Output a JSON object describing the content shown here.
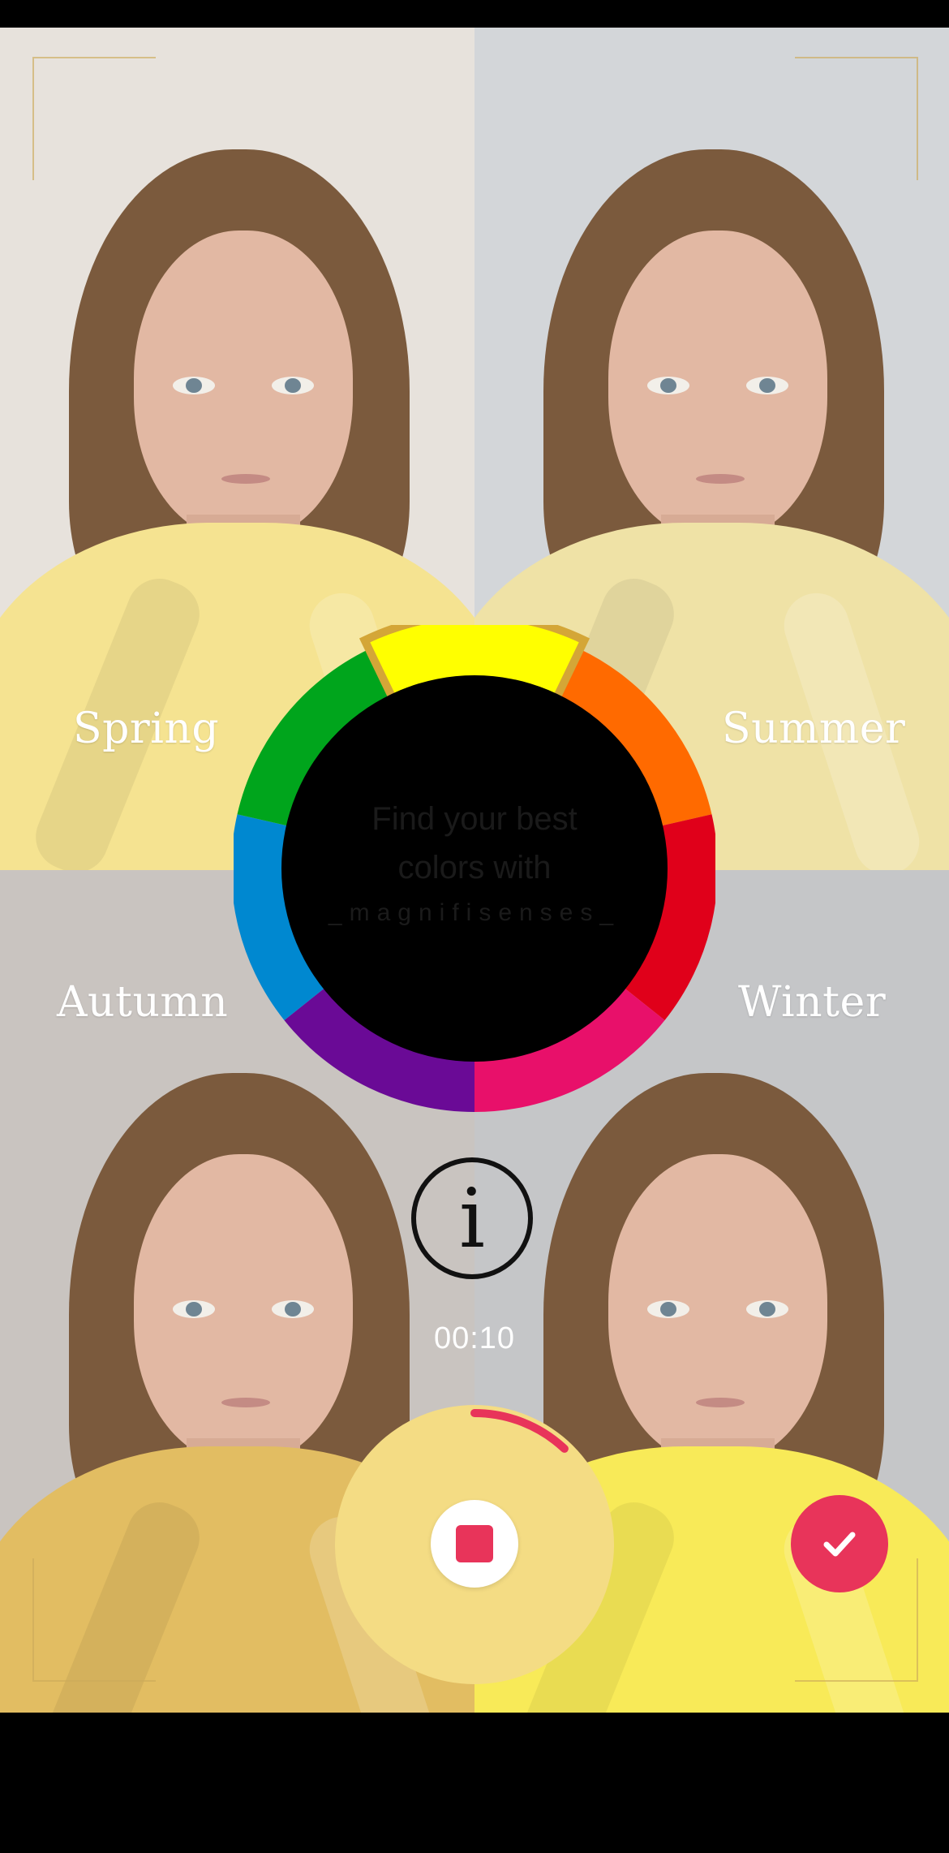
{
  "seasons": {
    "spring": "Spring",
    "summer": "Summer",
    "autumn": "Autumn",
    "winter": "Winter"
  },
  "wheel": {
    "line1": "Find your best",
    "line2": "colors with",
    "brand": "_magnifisenses_",
    "colors": [
      "#ffff00",
      "#ff6a00",
      "#e0001a",
      "#e8106a",
      "#6a0a96",
      "#0088d0",
      "#00a51c"
    ],
    "selected_color": "#ffff00",
    "accent_gold": "#d4a637"
  },
  "icons": {
    "info": "info-icon",
    "stop": "stop-icon",
    "confirm": "checkmark-icon"
  },
  "info_glyph": "i",
  "recording": {
    "timer": "00:10",
    "progress": 0.12,
    "accent": "#e8345a"
  }
}
